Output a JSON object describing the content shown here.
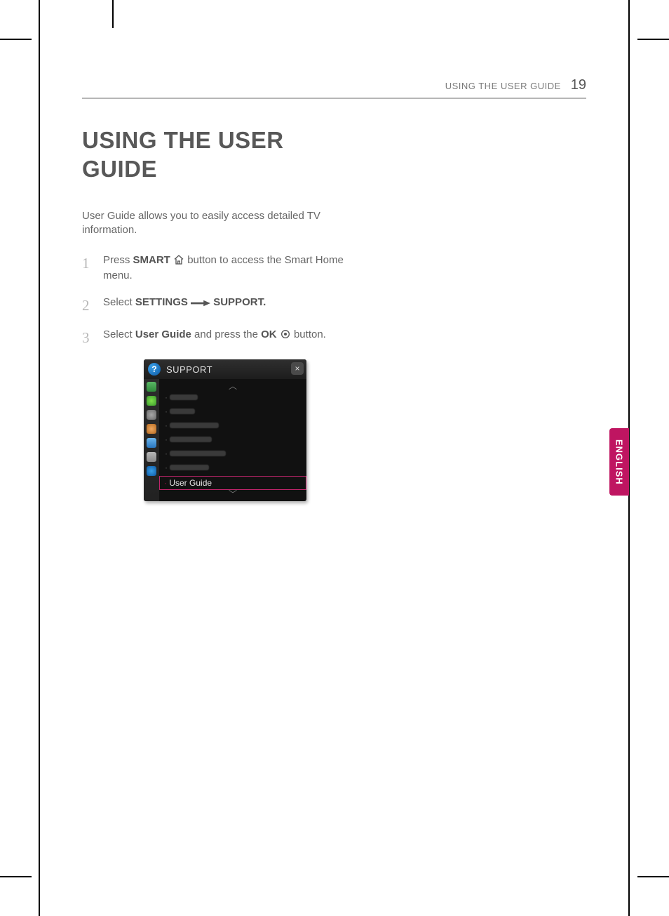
{
  "header": {
    "running": "USING THE USER GUIDE",
    "page": "19"
  },
  "title": "USING THE USER GUIDE",
  "intro": "User Guide allows you to easily access detailed TV information.",
  "steps": {
    "s1": {
      "num": "1",
      "pre": "Press ",
      "smart": "SMART",
      "post": " button to access the Smart Home menu."
    },
    "s2": {
      "num": "2",
      "pre": "Select ",
      "settings": "SETTINGS",
      "support": "SUPPORT."
    },
    "s3": {
      "num": "3",
      "pre": "Select ",
      "ug": "User Guide",
      "mid": " and press the ",
      "ok": "OK",
      "post": " button."
    }
  },
  "shot": {
    "title": "SUPPORT",
    "close": "×",
    "selected": "User Guide"
  },
  "lang": "ENGLISH"
}
